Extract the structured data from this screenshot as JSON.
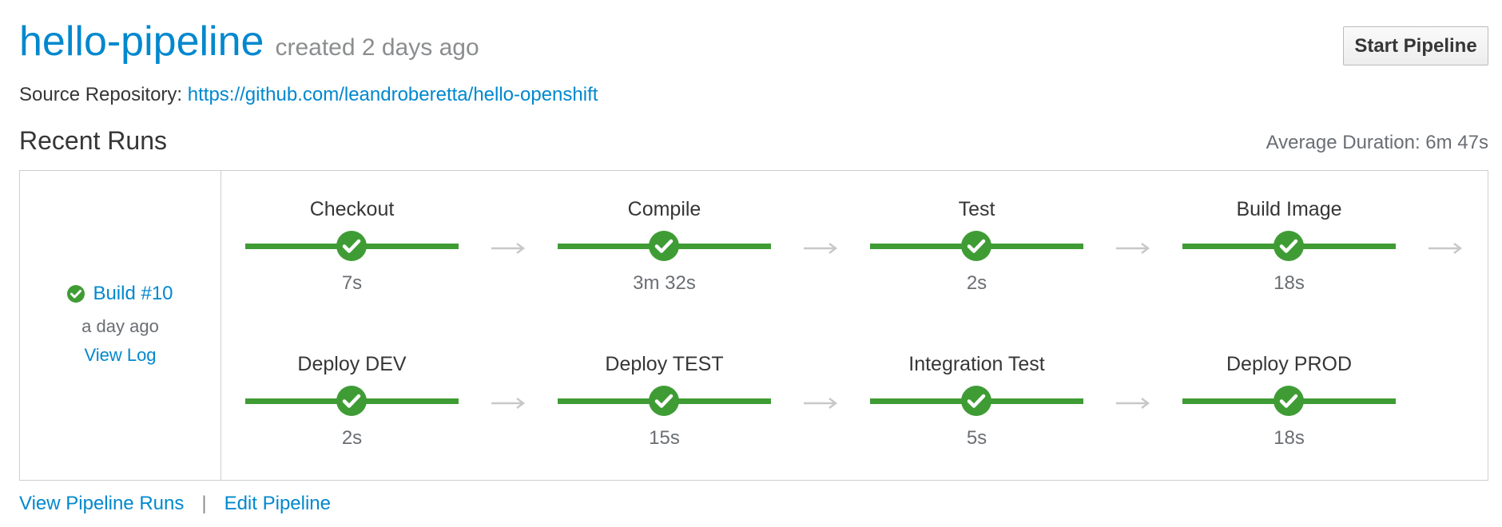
{
  "pipeline": {
    "name": "hello-pipeline",
    "created": "created 2 days ago",
    "start_button": "Start Pipeline",
    "source_label": "Source Repository:",
    "source_url": "https://github.com/leandroberetta/hello-openshift"
  },
  "recent_runs": {
    "title": "Recent Runs",
    "average_duration": "Average Duration: 6m 47s",
    "build": {
      "label": "Build #10",
      "time": "a day ago",
      "view_log": "View Log",
      "status": "success"
    },
    "stages": [
      {
        "name": "Checkout",
        "duration": "7s",
        "status": "success"
      },
      {
        "name": "Compile",
        "duration": "3m 32s",
        "status": "success"
      },
      {
        "name": "Test",
        "duration": "2s",
        "status": "success"
      },
      {
        "name": "Build Image",
        "duration": "18s",
        "status": "success"
      },
      {
        "name": "Deploy DEV",
        "duration": "2s",
        "status": "success"
      },
      {
        "name": "Deploy TEST",
        "duration": "15s",
        "status": "success"
      },
      {
        "name": "Integration Test",
        "duration": "5s",
        "status": "success"
      },
      {
        "name": "Deploy PROD",
        "duration": "18s",
        "status": "success"
      }
    ]
  },
  "footer": {
    "view_runs": "View Pipeline Runs",
    "separator": "|",
    "edit": "Edit Pipeline"
  },
  "colors": {
    "link": "#0088ce",
    "success": "#3f9c35",
    "arrow": "#c8c8c8"
  }
}
